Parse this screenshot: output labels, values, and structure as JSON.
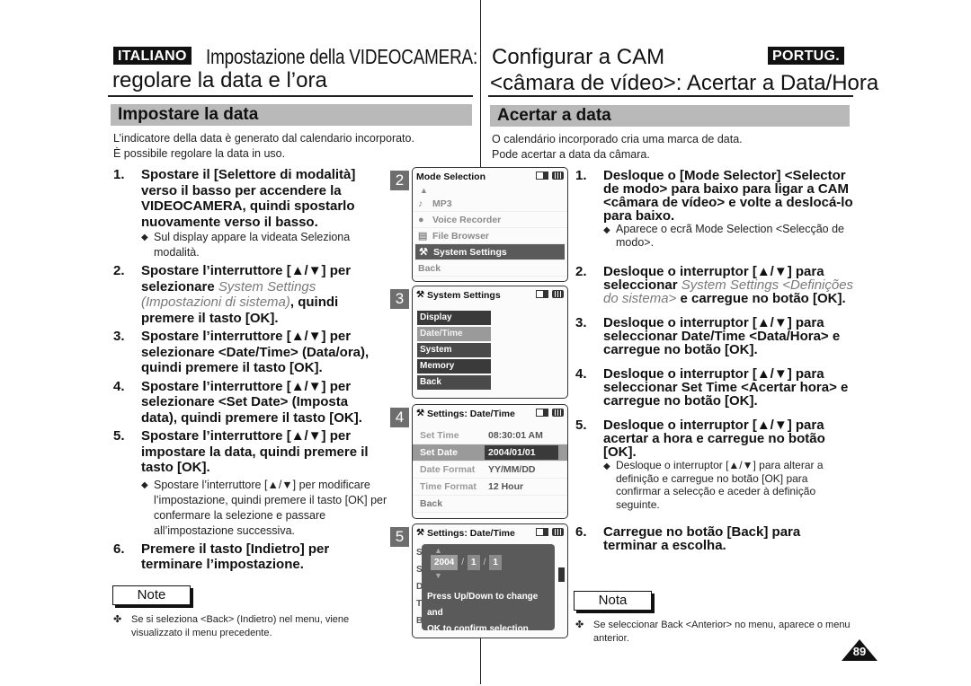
{
  "italian": {
    "lang_badge": "ITALIANO",
    "title_line1": "Impostazione della VIDEOCAMERA:",
    "title_line2": "regolare la data e l’ora",
    "section": "Impostare la data",
    "intro": [
      "L’indicatore della data è generato dal calendario incorporato.",
      "È possibile regolare la data in uso."
    ],
    "steps": [
      {
        "num": "1.",
        "text": "Spostare il [Selettore di modalità] verso il basso per accendere la VIDEOCAMERA, quindi spostarlo nuovamente verso il basso.",
        "sub": "Sul display appare la videata Seleziona modalità."
      },
      {
        "num": "2.",
        "text_a": "Spostare l’interruttore [▲/▼] per selezionare ",
        "italic": "System Settings (Impostazioni di sistema)",
        "text_b": ", quindi premere il tasto [OK]."
      },
      {
        "num": "3.",
        "text": "Spostare l’interruttore [▲/▼] per selezionare <Date/Time> (Data/ora), quindi premere il tasto [OK]."
      },
      {
        "num": "4.",
        "text": "Spostare l’interruttore [▲/▼] per selezionare <Set Date> (Imposta data), quindi premere il tasto [OK]."
      },
      {
        "num": "5.",
        "text": "Spostare l’interruttore [▲/▼] per impostare la data, quindi premere il tasto [OK].",
        "sub": "Spostare l’interruttore [▲/▼] per modificare l’impostazione, quindi premere il tasto [OK] per confermare la selezione e passare all’impostazione successiva."
      },
      {
        "num": "6.",
        "text": "Premere il tasto [Indietro] per terminare l’impostazione."
      }
    ],
    "note_label": "Note",
    "note_text": "Se si seleziona <Back> (Indietro) nel menu, viene visualizzato il menu precedente."
  },
  "portuguese": {
    "lang_badge": "PORTUG.",
    "title_line1": "Configurar a CAM",
    "title_line2": "<câmara de vídeo>: Acertar a Data/Hora",
    "section": "Acertar a data",
    "intro": [
      "O calendário incorporado cria uma marca de data.",
      "Pode acertar a data da câmara."
    ],
    "steps": [
      {
        "num": "1.",
        "text": "Desloque o [Mode Selector] <Selector de modo> para baixo para ligar a CAM <câmara de vídeo> e volte a deslocá-lo para baixo.",
        "sub": "Aparece o ecrã Mode Selection <Selecção de modo>."
      },
      {
        "num": "2.",
        "text_a": "Desloque o interruptor [▲/▼] para seleccionar ",
        "italic": "System Settings <Definições do sistema>",
        "text_b": " e carregue no botão [OK]."
      },
      {
        "num": "3.",
        "text": "Desloque o interruptor [▲/▼] para seleccionar Date/Time <Data/Hora> e carregue no botão [OK]."
      },
      {
        "num": "4.",
        "text": "Desloque o interruptor [▲/▼] para seleccionar Set Time <Acertar hora> e carregue no botão [OK]."
      },
      {
        "num": "5.",
        "text": "Desloque o interruptor [▲/▼] para acertar a hora e carregue no botão [OK].",
        "sub": "Desloque o interruptor [▲/▼] para alterar a definição e carregue no botão [OK] para confirmar a selecção e aceder à definição seguinte."
      },
      {
        "num": "6.",
        "text": "Carregue no botão [Back] para terminar a escolha."
      }
    ],
    "note_label": "Nota",
    "note_text": "Se seleccionar Back <Anterior> no menu, aparece o menu anterior."
  },
  "screens": {
    "s2": {
      "step": "2",
      "title": "Mode Selection",
      "items": [
        {
          "icon": "♪",
          "label": "MP3"
        },
        {
          "icon": "🎙",
          "label": "Voice Recorder"
        },
        {
          "icon": "▤",
          "label": "File Browser"
        },
        {
          "icon": "⫶T",
          "label": "System Settings",
          "selected": true
        }
      ],
      "back": "Back"
    },
    "s3": {
      "step": "3",
      "title": "System Settings",
      "items": [
        "Display",
        "Date/Time",
        "System",
        "Memory",
        "Back"
      ],
      "selected_index": 1
    },
    "s4": {
      "step": "4",
      "title": "Settings: Date/Time",
      "rows": [
        {
          "key": "Set Time",
          "value": "08:30:01 AM"
        },
        {
          "key": "Set Date",
          "value": "2004/01/01"
        },
        {
          "key": "Date Format",
          "value": "YY/MM/DD"
        },
        {
          "key": "Time Format",
          "value": "12 Hour"
        },
        {
          "key": "Back",
          "value": ""
        }
      ]
    },
    "s5": {
      "step": "5",
      "title": "Settings: Date/Time",
      "year": "2004",
      "month": "1",
      "day": "1",
      "separator": "/",
      "message_line1": "Press Up/Down to change and",
      "message_line2": "OK to confirm selection",
      "ghost": [
        "S",
        "S",
        "D",
        "T",
        "B"
      ]
    }
  },
  "page_number": "89",
  "bullet_diamond": "◆",
  "bullet_note": "✤"
}
